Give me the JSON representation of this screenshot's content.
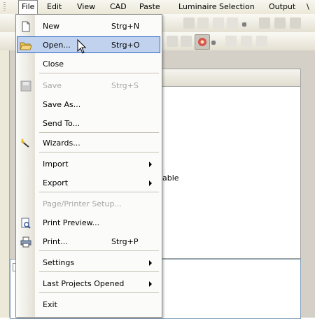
{
  "menubar": {
    "items": [
      {
        "label": "File",
        "active": true
      },
      {
        "label": "Edit"
      },
      {
        "label": "View"
      },
      {
        "label": "CAD"
      },
      {
        "label": "Paste"
      },
      {
        "label": "Luminaire Selection"
      },
      {
        "label": "Output"
      },
      {
        "label": "\\"
      }
    ]
  },
  "background": {
    "partial_label": "able"
  },
  "file_menu": {
    "items": [
      {
        "label": "New",
        "shortcut": "Strg+N",
        "icon": "new-document-icon",
        "enabled": true
      },
      {
        "label": "Open...",
        "shortcut": "Strg+O",
        "icon": "open-folder-icon",
        "enabled": true,
        "highlighted": true
      },
      {
        "label": "Close",
        "shortcut": "",
        "icon": "",
        "enabled": true
      },
      {
        "label": "Save",
        "shortcut": "Strg+S",
        "icon": "save-disk-icon",
        "enabled": false
      },
      {
        "label": "Save As...",
        "shortcut": "",
        "icon": "",
        "enabled": true
      },
      {
        "label": "Send To...",
        "shortcut": "",
        "icon": "",
        "enabled": true
      },
      {
        "label": "Wizards...",
        "shortcut": "",
        "icon": "wizard-wand-icon",
        "enabled": true
      },
      {
        "label": "Import",
        "shortcut": "",
        "icon": "",
        "enabled": true,
        "submenu": true
      },
      {
        "label": "Export",
        "shortcut": "",
        "icon": "",
        "enabled": true,
        "submenu": true
      },
      {
        "label": "Page/Printer Setup...",
        "shortcut": "",
        "icon": "",
        "enabled": false
      },
      {
        "label": "Print Preview...",
        "shortcut": "",
        "icon": "print-preview-icon",
        "enabled": true
      },
      {
        "label": "Print...",
        "shortcut": "Strg+P",
        "icon": "printer-icon",
        "enabled": true
      },
      {
        "label": "Settings",
        "shortcut": "",
        "icon": "",
        "enabled": true,
        "submenu": true
      },
      {
        "label": "Last Projects Opened",
        "shortcut": "",
        "icon": "",
        "enabled": true,
        "submenu": true
      },
      {
        "label": "Exit",
        "shortcut": "",
        "icon": "",
        "enabled": true
      }
    ]
  },
  "colors": {
    "highlight_fill": "#c1d2ee",
    "highlight_border": "#316ac5",
    "disabled_text": "#a6a6a6"
  }
}
